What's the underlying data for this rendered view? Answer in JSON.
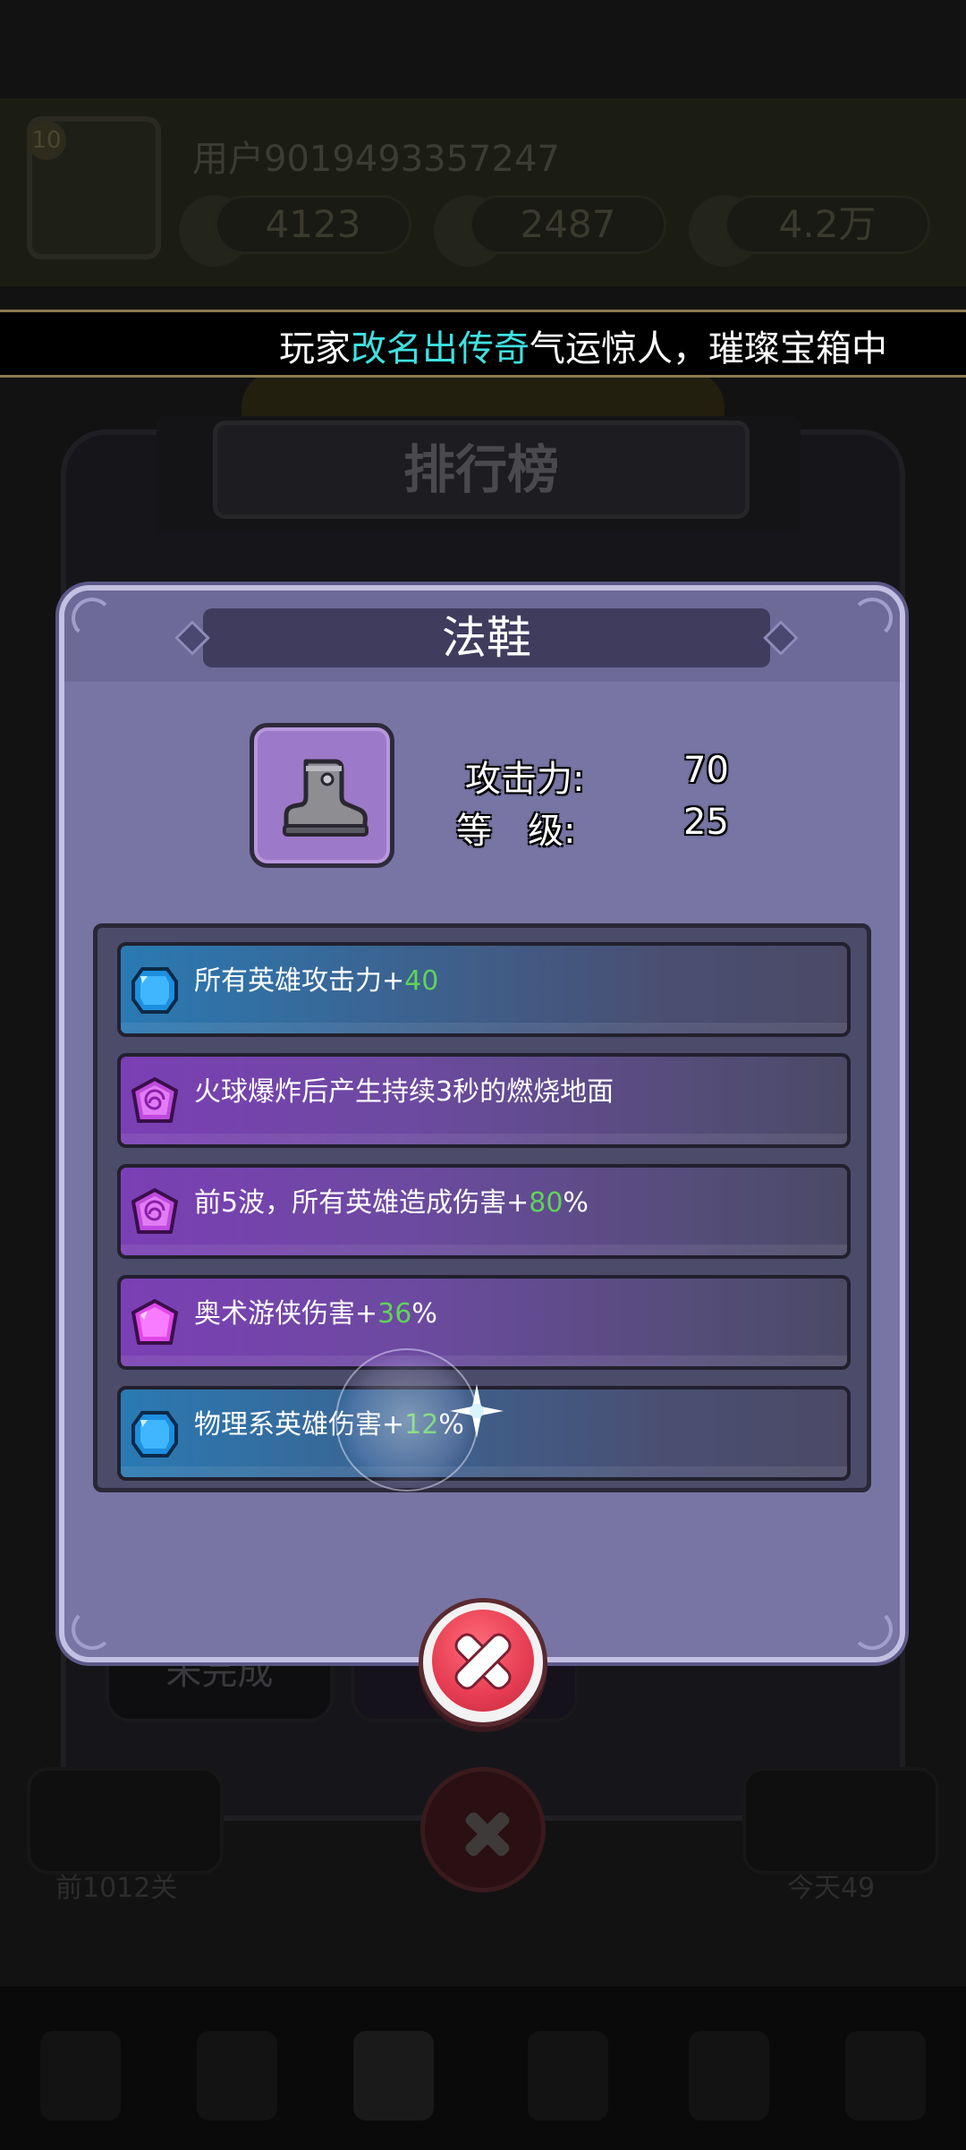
{
  "background": {
    "level": "10",
    "username": "用户9019493357247",
    "resources": [
      "4123",
      "2487",
      "4.2万"
    ],
    "board_title": "排行榜",
    "tabs": [
      "未完成",
      ""
    ],
    "side_labels": [
      "前1012关",
      "今天49"
    ]
  },
  "marquee": {
    "prefix": "玩家",
    "highlight": "改名出传奇",
    "suffix": "气运惊人，璀璨宝箱中"
  },
  "modal": {
    "title": "法鞋",
    "item_icon": "boot-icon",
    "stats": [
      {
        "label": "攻击力:",
        "value": "70"
      },
      {
        "label": "等　级:",
        "value": "25"
      }
    ],
    "affixes": [
      {
        "gem": "blue-gem-icon",
        "style": "blue",
        "text": "所有英雄攻击力+",
        "num": "40",
        "unit": ""
      },
      {
        "gem": "purple-gem-icon",
        "style": "purple",
        "text": "火球爆炸后产生持续3秒的燃烧地面",
        "num": "",
        "unit": ""
      },
      {
        "gem": "purple-gem-icon",
        "style": "purple",
        "text": "前5波，所有英雄造成伤害+",
        "num": "80",
        "unit": "%"
      },
      {
        "gem": "pink-gem-icon",
        "style": "purple",
        "text": "奥术游侠伤害+",
        "num": "36",
        "unit": "%"
      },
      {
        "gem": "blue-gem-icon",
        "style": "blue",
        "text": "物理系英雄伤害+",
        "num": "12",
        "unit": "%"
      }
    ],
    "close_icon": "close-icon"
  },
  "colors": {
    "modal_bg": "#7875a4",
    "modal_border": "#c4c0e3",
    "highlight_text": "#3fe0e0",
    "bonus_number": "#5fd35a",
    "close_red": "#e63c52"
  }
}
